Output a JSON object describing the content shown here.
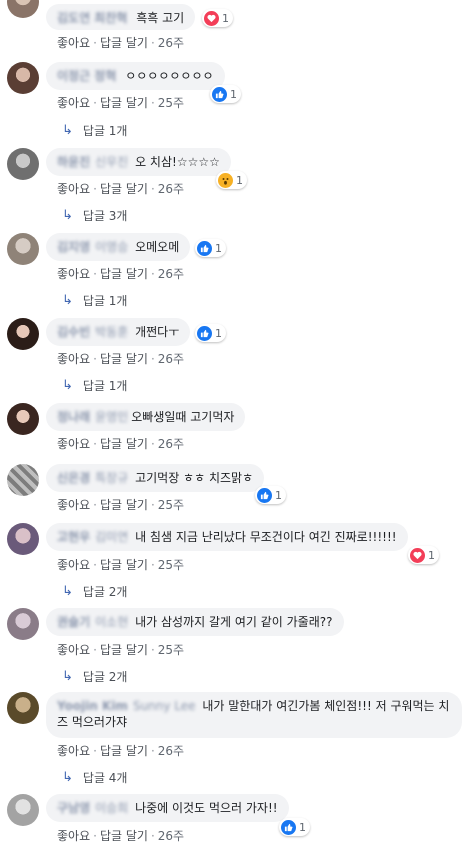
{
  "comments": [
    {
      "author": "김도연 최찬혁",
      "author2": "",
      "text": "흑흑 고기",
      "time": "26주",
      "reaction": {
        "type": "love",
        "count": "1"
      },
      "replies": ""
    },
    {
      "author": "이정근 정혁",
      "author2": "",
      "text": "ㅇㅇㅇㅇㅇㅇㅇㅇ",
      "time": "25주",
      "reaction": {
        "type": "like",
        "count": "1"
      },
      "replies": "답글 1개"
    },
    {
      "author": "하윤진",
      "author2": "신우진",
      "text": "오 치삼!☆☆☆☆",
      "time": "26주",
      "reaction": {
        "type": "wow",
        "count": "1"
      },
      "replies": "답글 3개"
    },
    {
      "author": "김지영",
      "author2": "이영승",
      "text": "오메오메",
      "time": "26주",
      "reaction": {
        "type": "like",
        "count": "1"
      },
      "replies": "답글 1개"
    },
    {
      "author": "김수빈",
      "author2": "박동훈",
      "text": "개쩐다ㅜ",
      "time": "26주",
      "reaction": {
        "type": "like",
        "count": "1"
      },
      "replies": "답글 1개"
    },
    {
      "author": "정나래",
      "author2": "윤영민",
      "text": "오빠생일때 고기먹자",
      "time": "26주",
      "reaction": null,
      "replies": ""
    },
    {
      "author": "신은경",
      "author2": "특장규",
      "text": "고기먹장 ㅎㅎ 치즈맑ㅎ",
      "time": "25주",
      "reaction": {
        "type": "like",
        "count": "1"
      },
      "replies": ""
    },
    {
      "author": "고현우",
      "author2": "김미연",
      "text": "내 침샘 지금 난리났다 무조건이다 여긴 진짜로!!!!!!",
      "time": "25주",
      "reaction": {
        "type": "love",
        "count": "1"
      },
      "replies": "답글 2개"
    },
    {
      "author": "권슬기",
      "author2": "이소현",
      "text": "내가 삼성까지 갈게 여기 같이 가줄래??",
      "time": "25주",
      "reaction": null,
      "replies": "답글 2개"
    },
    {
      "author": "Yoojin Kim",
      "author2": "Sunny Lee",
      "text": "내가 말한대가 여긴가봄 체인점!!! 저 구워먹는 치즈 먹으러가쟈",
      "time": "26주",
      "reaction": null,
      "replies": "답글 4개"
    },
    {
      "author": "구남영",
      "author2": "이승희",
      "text": "나중에 이것도 먹으러 가자!!",
      "time": "26주",
      "reaction": {
        "type": "like",
        "count": "1"
      },
      "replies": ""
    }
  ],
  "actions": {
    "like": "좋아요",
    "reply": "답글 달기",
    "sep": "·"
  },
  "colors": {
    "bubble": "#f2f3f5",
    "like": "#1877f2",
    "love": "#f33e58",
    "wow": "#f7b125",
    "link": "#4267b2"
  },
  "icons": {
    "like": "thumbs-up-icon",
    "love": "heart-icon",
    "wow": "wow-face-icon",
    "reply": "reply-arrow-icon"
  }
}
